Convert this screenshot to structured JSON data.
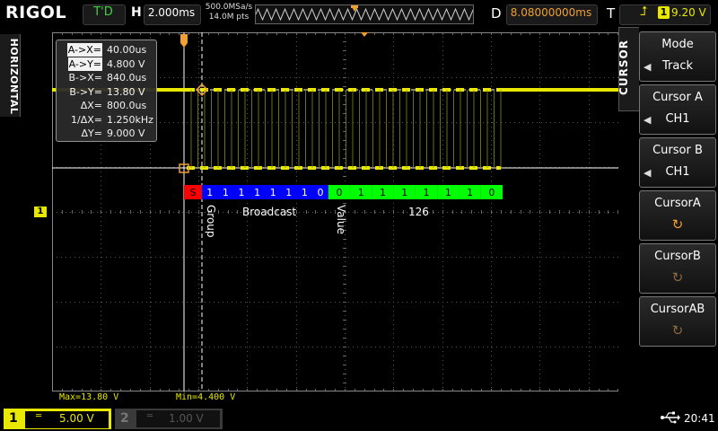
{
  "brand": "RIGOL",
  "top": {
    "run_state": "T'D",
    "h_label": "H",
    "timebase": "2.000ms",
    "sample_rate": "500.0MSa/s",
    "mem_depth": "14.0M pts",
    "d_label": "D",
    "delay": "8.08000000ms",
    "t_label": "T",
    "trigger_source": "1",
    "trigger_level": "9.20 V"
  },
  "left_tab": "HORIZONTAL",
  "right_tab": "CURSOR",
  "menu": [
    {
      "title": "Mode",
      "value": "Track"
    },
    {
      "title": "Cursor A",
      "value": "CH1"
    },
    {
      "title": "Cursor B",
      "value": "CH1"
    },
    {
      "title": "CursorA",
      "value": ""
    },
    {
      "title": "CursorB",
      "value": ""
    },
    {
      "title": "CursorAB",
      "value": ""
    }
  ],
  "readout": [
    {
      "key": "A->X=",
      "value": "40.00us",
      "highlight": true
    },
    {
      "key": "A->Y=",
      "value": "4.800 V",
      "highlight": true
    },
    {
      "key": "B->X=",
      "value": "840.0us",
      "highlight": false
    },
    {
      "key": "B->Y=",
      "value": "13.80 V",
      "highlight": false
    },
    {
      "key": "ΔX=",
      "value": "800.0us",
      "highlight": false
    },
    {
      "key": "1/ΔX=",
      "value": "1.250kHz",
      "highlight": false
    },
    {
      "key": "ΔY=",
      "value": "9.000 V",
      "highlight": false
    }
  ],
  "decode": {
    "bits": [
      "S",
      "1",
      "1",
      "1",
      "1",
      "1",
      "1",
      "1",
      "0",
      "0",
      "1",
      "1",
      "1",
      "1",
      "1",
      "1",
      "0"
    ],
    "labels": {
      "group": "Group",
      "broadcast": "Broadcast",
      "value": "Value",
      "number": "126"
    },
    "colors": {
      "start": "#ff0000",
      "address": "#0000ff",
      "data": "#00ff00"
    }
  },
  "ch1_marker": "1",
  "maxmin": {
    "max": "Max=13.80 V",
    "min": "Min=4.400 V"
  },
  "bottom": {
    "ch1": {
      "num": "1",
      "coupling": "═",
      "scale": "5.00 V"
    },
    "ch2": {
      "num": "2",
      "coupling": "═",
      "scale": "1.00 V"
    },
    "usb_icon": "usb-icon",
    "time": "20:41"
  },
  "colors": {
    "ch1": "#e8e800",
    "accent": "#f0a030",
    "td": "#3fd23f"
  }
}
